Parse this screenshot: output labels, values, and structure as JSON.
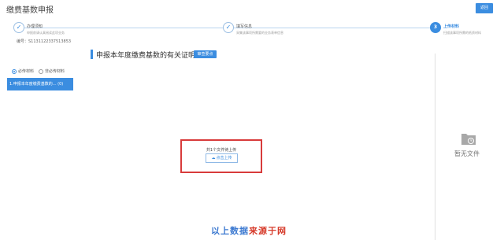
{
  "header": {
    "title": "缴费基数申报",
    "back_label": "返回"
  },
  "steps": [
    {
      "title": "办理须知",
      "desc": "申报前请认真阅读此项业务",
      "status": "done",
      "icon": "check-icon"
    },
    {
      "title": "填写信息",
      "desc": "采集该事项所需要的业务表单信息",
      "status": "done",
      "icon": "check-icon"
    },
    {
      "title": "上传材料",
      "desc": "扫描该事项所需的纸质材料",
      "status": "active",
      "number": "3"
    }
  ],
  "serial": "编号：S1131122337513853",
  "section": {
    "title": "申报本年度缴费基数的有关证明",
    "badge": "审查要点"
  },
  "filter": {
    "options": [
      "必传材料",
      "非必传材料"
    ],
    "selected": 0
  },
  "materials": [
    {
      "label": "1.申报本年度缴费基数的... (0)"
    }
  ],
  "upload": {
    "count_text": "共1个文件待上传",
    "button_label": "点击上传",
    "button_icon": "upload-cloud-icon"
  },
  "preview": {
    "empty_text": "暂无文件",
    "empty_icon": "folder-clock-icon"
  },
  "watermark": {
    "text_blue": "以上数据",
    "text_red": "来源",
    "text_end": "于网"
  },
  "colors": {
    "accent": "#3b8de0",
    "highlight_border": "#d83b3b"
  }
}
